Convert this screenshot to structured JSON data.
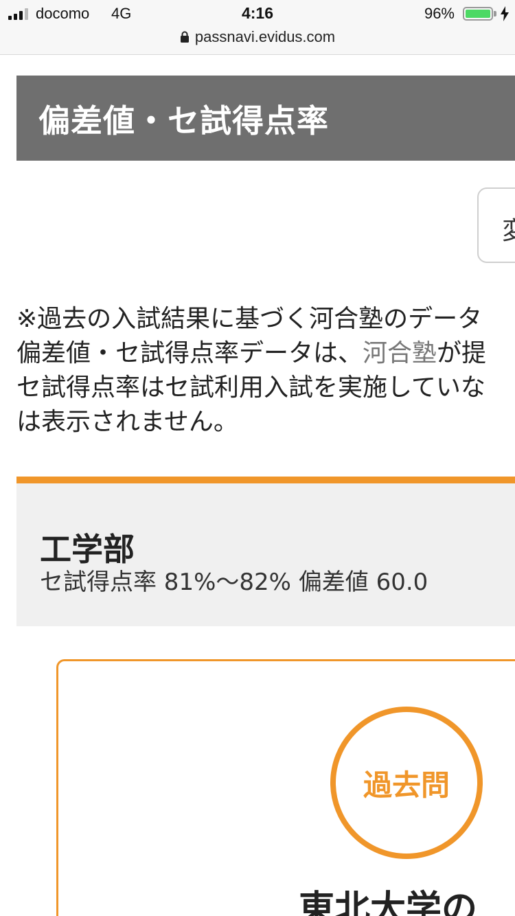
{
  "status_bar": {
    "carrier": "docomo",
    "network": "4G",
    "time": "4:16",
    "battery_percent": "96%",
    "battery_color": "#4cd964"
  },
  "address_bar": {
    "url": "passnavi.evidus.com",
    "icon": "lock-icon"
  },
  "section": {
    "title": "偏差値・セ試得点率",
    "color": "#6f6f6f"
  },
  "change_button": {
    "label": "変更"
  },
  "note": {
    "line1": "※過去の入試結果に基づく河合塾のデータ",
    "line2_prefix": "偏差値・セ試得点率データは、",
    "line2_link": "河合塾",
    "line2_suffix": "が提",
    "line3": "セ試得点率はセ試利用入試を実施していな",
    "line4": "は表示されません。"
  },
  "faculty": {
    "name": "工学部",
    "stats": "セ試得点率 81%〜82% 偏差値 60.0",
    "accent_color": "#f0962a"
  },
  "past_exam": {
    "badge_label": "過去問",
    "title": "東北大学の"
  }
}
